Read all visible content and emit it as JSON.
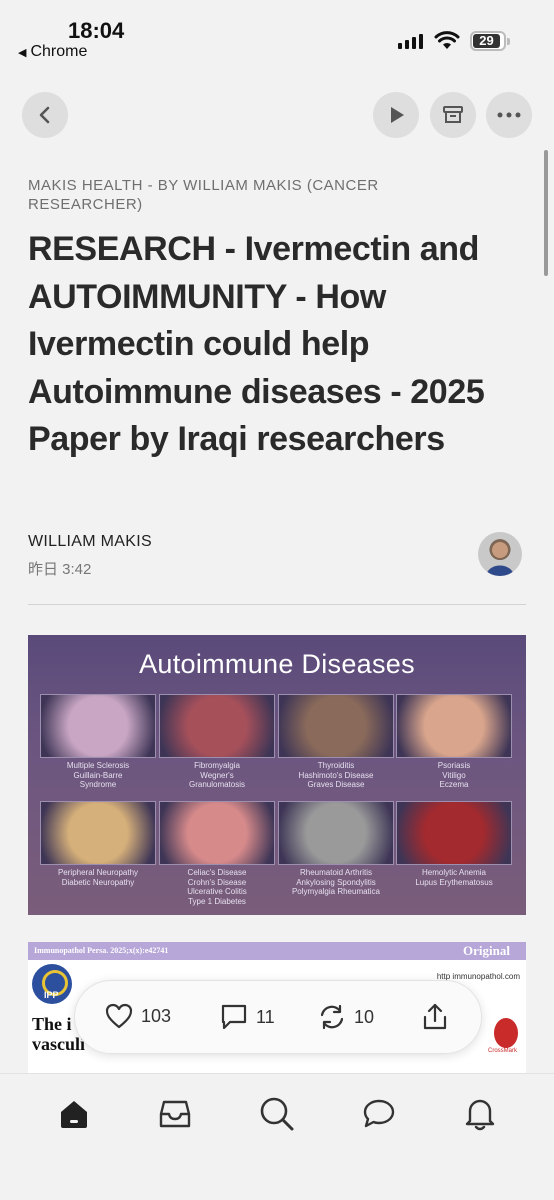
{
  "status_bar": {
    "time": "18:04",
    "back_app": "Chrome",
    "battery": "29"
  },
  "article": {
    "publication": "MAKIS HEALTH - BY WILLIAM MAKIS (CANCER RESEARCHER)",
    "title": "RESEARCH - Ivermectin and AUTOIMMUNITY - How Ivermectin could help Autoimmune diseases - 2025 Paper by Iraqi researchers",
    "author": "WILLIAM MAKIS",
    "date": "昨日 3:42"
  },
  "image": {
    "title": "Autoimmune Diseases",
    "tiles": [
      {
        "caption": "Multiple Sclerosis\nGuillain-Barre\nSyndrome",
        "color": "#c9a6c4"
      },
      {
        "caption": "Fibromyalgia\nWegner's\nGranulomatosis",
        "color": "#a6505a"
      },
      {
        "caption": "Thyroiditis\nHashimoto's Disease\nGraves Disease",
        "color": "#8a6a5a"
      },
      {
        "caption": "Psoriasis\nVitiligo\nEczema",
        "color": "#d9a58c"
      },
      {
        "caption": "Peripheral Neuropathy\nDiabetic Neuropathy",
        "color": "#d6b07a"
      },
      {
        "caption": "Celiac's Disease\nCrohn's Disease\nUlcerative Colitis\nType 1 Diabetes",
        "color": "#d68a8a"
      },
      {
        "caption": "Rheumatoid Arthritis\nAnkylosing Spondylitis\nPolymyalgia Rheumatica",
        "color": "#9a9a9a"
      },
      {
        "caption": "Hemolytic Anemia\nLupus Erythematosus",
        "color": "#a32a2e"
      }
    ]
  },
  "paper": {
    "journal": "Immunopathol Persa. 2025;x(x):e42741",
    "label": "Original",
    "url": "http immunopathol.com",
    "logo_text": "IPP",
    "visible_text": "The i\nvasculi",
    "crossmark": "CrossMark"
  },
  "reactions": {
    "likes": "103",
    "comments": "11",
    "restacks": "10"
  },
  "colors": {
    "background": "#f2f2f2",
    "button_bg": "#dedede",
    "image_bg": "#5a4a7a"
  },
  "icons": [
    "back-icon",
    "play-icon",
    "archive-icon",
    "more-icon",
    "heart-icon",
    "comment-icon",
    "restack-icon",
    "share-icon",
    "home-icon",
    "inbox-icon",
    "search-icon",
    "chat-icon",
    "bell-icon"
  ]
}
